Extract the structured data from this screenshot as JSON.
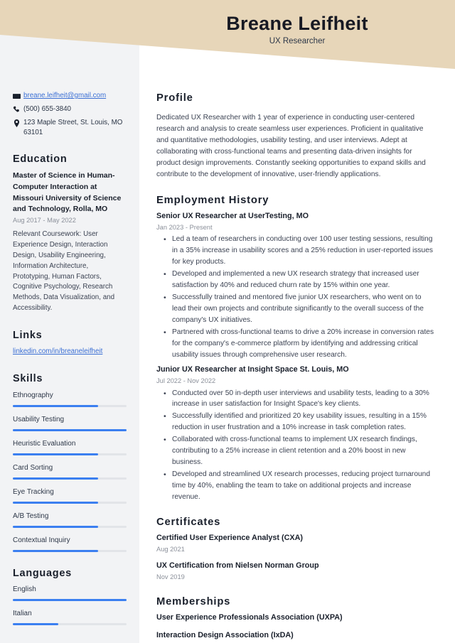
{
  "header": {
    "name": "Breane Leifheit",
    "job_title": "UX Researcher",
    "background_color": "#e7d6b9"
  },
  "theme": {
    "sidebar_background": "#f2f3f5",
    "accent_blue": "#3b7ff0",
    "link_blue": "#3b6fd4",
    "muted_text": "#8b909a"
  },
  "sidebar": {
    "contact": [
      {
        "icon": "envelope-icon",
        "value": "breane.leifheit@gmail.com",
        "is_link": true
      },
      {
        "icon": "phone-icon",
        "value": "(500) 655-3840",
        "is_link": false
      },
      {
        "icon": "map-pin-icon",
        "value": "123 Maple Street, St. Louis, MO 63101",
        "is_link": false
      }
    ],
    "education": {
      "heading": "Education",
      "entries": [
        {
          "title": "Master of Science in Human-Computer Interaction at Missouri University of Science and Technology, Rolla, MO",
          "date": "Aug 2017 - May 2022",
          "description": "Relevant Coursework: User Experience Design, Interaction Design, Usability Engineering, Information Architecture, Prototyping, Human Factors, Cognitive Psychology, Research Methods, Data Visualization, and Accessibility."
        }
      ]
    },
    "links": {
      "heading": "Links",
      "items": [
        {
          "label": "linkedin.com/in/breaneleifheit"
        }
      ]
    },
    "skills": {
      "heading": "Skills",
      "items": [
        {
          "label": "Ethnography",
          "level": 75
        },
        {
          "label": "Usability Testing",
          "level": 100
        },
        {
          "label": "Heuristic Evaluation",
          "level": 75
        },
        {
          "label": "Card Sorting",
          "level": 75
        },
        {
          "label": "Eye Tracking",
          "level": 75
        },
        {
          "label": "A/B Testing",
          "level": 75
        },
        {
          "label": "Contextual Inquiry",
          "level": 75
        }
      ]
    },
    "languages": {
      "heading": "Languages",
      "items": [
        {
          "label": "English",
          "level": 100
        },
        {
          "label": "Italian",
          "level": 40
        }
      ]
    }
  },
  "main": {
    "profile": {
      "heading": "Profile",
      "text": "Dedicated UX Researcher with 1 year of experience in conducting user-centered research and analysis to create seamless user experiences. Proficient in qualitative and quantitative methodologies, usability testing, and user interviews. Adept at collaborating with cross-functional teams and presenting data-driven insights for product design improvements. Constantly seeking opportunities to expand skills and contribute to the development of innovative, user-friendly applications."
    },
    "employment": {
      "heading": "Employment History",
      "jobs": [
        {
          "title": "Senior UX Researcher at UserTesting, MO",
          "date": "Jan 2023 - Present",
          "bullets": [
            "Led a team of researchers in conducting over 100 user testing sessions, resulting in a 35% increase in usability scores and a 25% reduction in user-reported issues for key products.",
            "Developed and implemented a new UX research strategy that increased user satisfaction by 40% and reduced churn rate by 15% within one year.",
            "Successfully trained and mentored five junior UX researchers, who went on to lead their own projects and contribute significantly to the overall success of the company's UX initiatives.",
            "Partnered with cross-functional teams to drive a 20% increase in conversion rates for the company's e-commerce platform by identifying and addressing critical usability issues through comprehensive user research."
          ]
        },
        {
          "title": "Junior UX Researcher at Insight Space St. Louis, MO",
          "date": "Jul 2022 - Nov 2022",
          "bullets": [
            "Conducted over 50 in-depth user interviews and usability tests, leading to a 30% increase in user satisfaction for Insight Space's key clients.",
            "Successfully identified and prioritized 20 key usability issues, resulting in a 15% reduction in user frustration and a 10% increase in task completion rates.",
            "Collaborated with cross-functional teams to implement UX research findings, contributing to a 25% increase in client retention and a 20% boost in new business.",
            "Developed and streamlined UX research processes, reducing project turnaround time by 40%, enabling the team to take on additional projects and increase revenue."
          ]
        }
      ]
    },
    "certificates": {
      "heading": "Certificates",
      "items": [
        {
          "title": "Certified User Experience Analyst (CXA)",
          "date": "Aug 2021"
        },
        {
          "title": "UX Certification from Nielsen Norman Group",
          "date": "Nov 2019"
        }
      ]
    },
    "memberships": {
      "heading": "Memberships",
      "items": [
        {
          "title": "User Experience Professionals Association (UXPA)"
        },
        {
          "title": "Interaction Design Association (IxDA)"
        }
      ]
    }
  }
}
